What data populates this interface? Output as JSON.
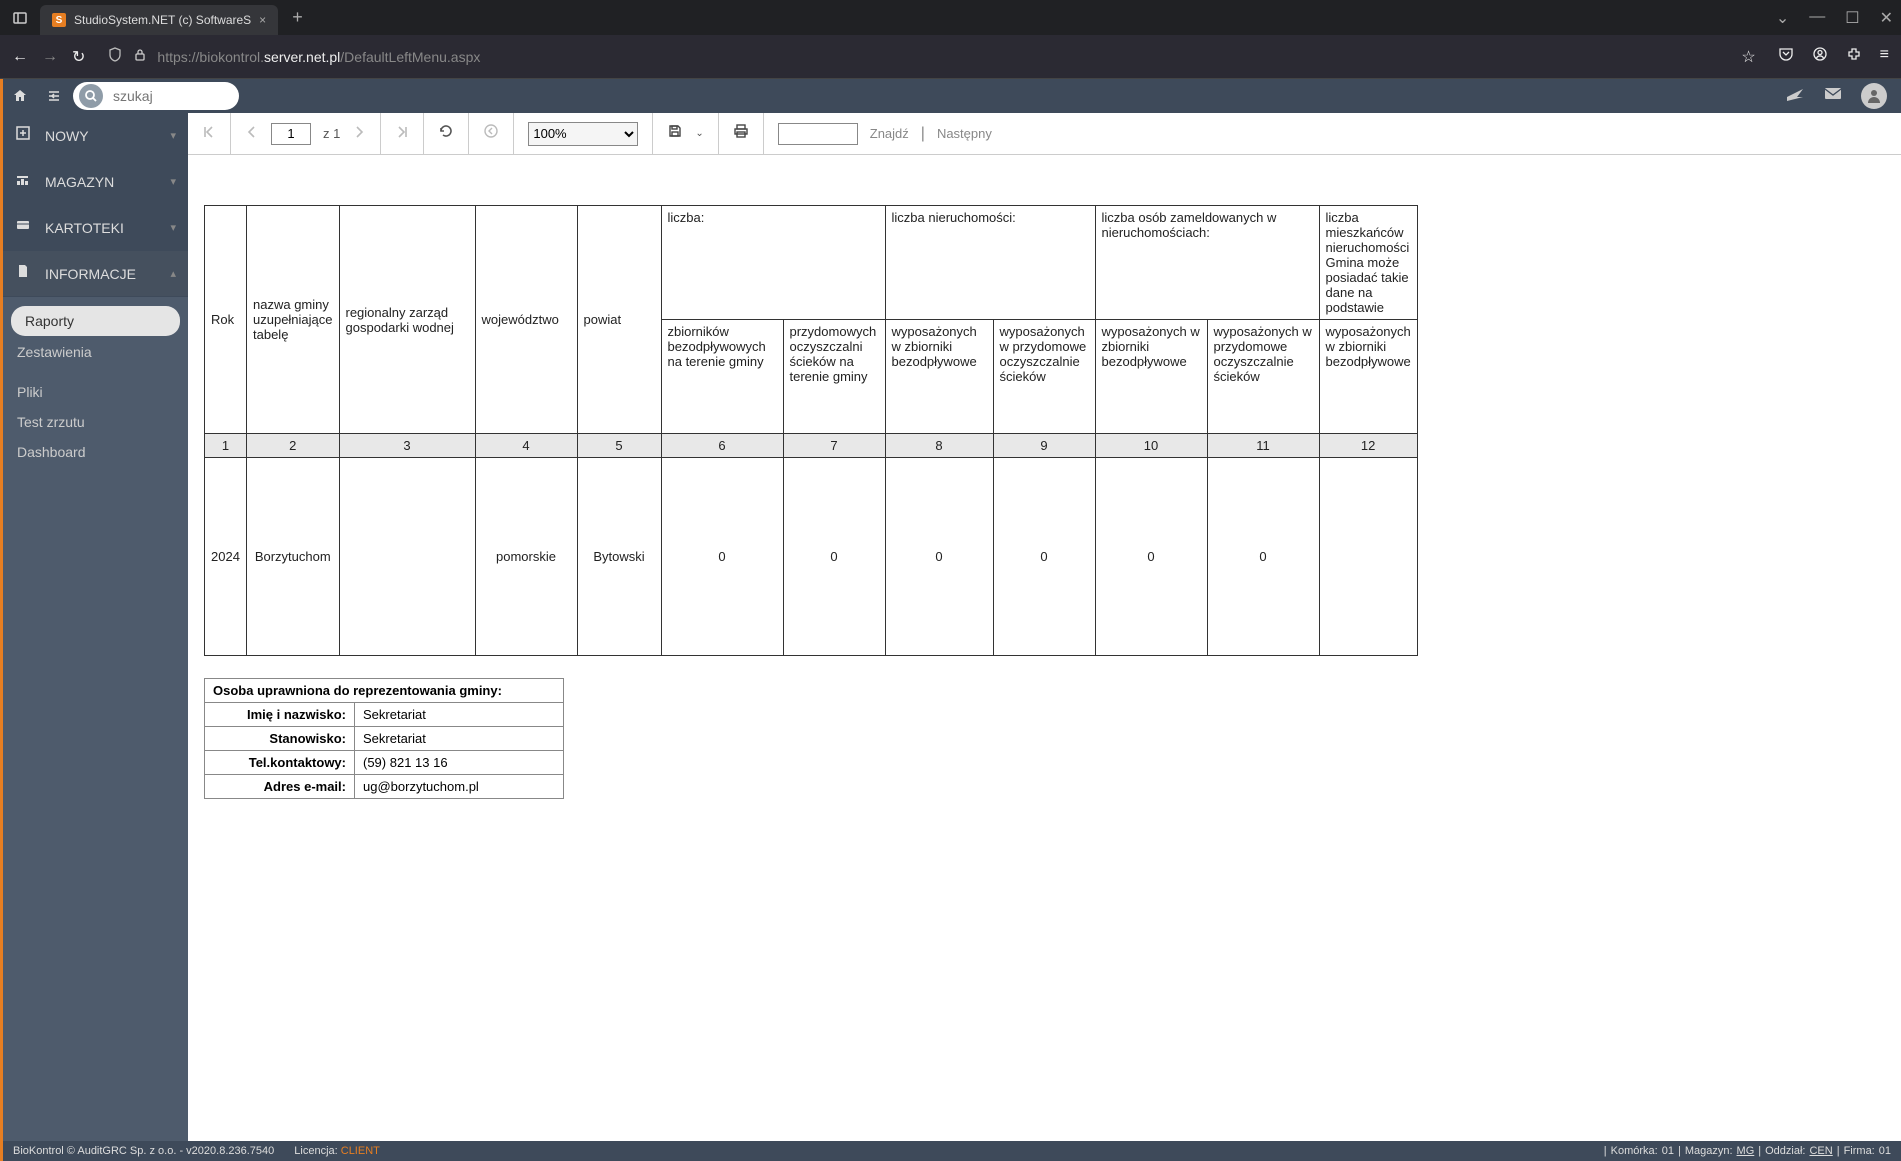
{
  "browser": {
    "tab_title": "StudioSystem.NET (c) SoftwareS",
    "url_prefix": "https://biokontrol.",
    "url_mid": "server.net.pl",
    "url_suffix": "/DefaultLeftMenu.aspx"
  },
  "search": {
    "placeholder": "szukaj"
  },
  "sidebar": {
    "items": [
      {
        "label": "NOWY"
      },
      {
        "label": "MAGAZYN"
      },
      {
        "label": "KARTOTEKI"
      },
      {
        "label": "INFORMACJE"
      }
    ],
    "sub": [
      {
        "label": "Raporty",
        "active": true
      },
      {
        "label": "Zestawienia",
        "active": false
      },
      {
        "label": "Pliki",
        "active": false
      },
      {
        "label": "Test zrzutu",
        "active": false
      },
      {
        "label": "Dashboard",
        "active": false
      }
    ]
  },
  "report_toolbar": {
    "page_value": "1",
    "page_of_prefix": "z ",
    "page_of": "1",
    "zoom": "100%",
    "find_label": "Znajdź",
    "next_label": "Następny"
  },
  "table": {
    "group_headers": {
      "liczba": "liczba:",
      "liczba_nieruch": "liczba nieruchomości:",
      "liczba_osob": "liczba osób zameldowanych w nieruchomościach:",
      "liczba_mies": "liczba mieszkańców nieruchomości Gmina może posiadać takie dane na podstawie"
    },
    "columns": [
      "Rok",
      "nazwa gminy uzupełniające tabelę",
      "regionalny zarząd gospodarki wodnej",
      "województwo",
      "powiat",
      "zbiorników bezodpływowych na terenie gminy",
      "przydomowych oczyszczalni ścieków na terenie gminy",
      "wyposażonych w zbiorniki bezodpływowe",
      "wyposażonych w przydomowe oczyszczalnie ścieków",
      "wyposażonych w zbiorniki bezodpływowe",
      "wyposażonych w przydomowe oczyszczalnie ścieków",
      "wyposażonych w zbiorniki bezodpływowe"
    ],
    "numrow": [
      "1",
      "2",
      "3",
      "4",
      "5",
      "6",
      "7",
      "8",
      "9",
      "10",
      "11",
      "12"
    ],
    "data": {
      "rok": "2024",
      "gmina": "Borzytuchom",
      "rzgw": "",
      "woj": "pomorskie",
      "powiat": "Bytowski",
      "c6": "0",
      "c7": "0",
      "c8": "0",
      "c9": "0",
      "c10": "0",
      "c11": "0",
      "c12": ""
    }
  },
  "contact": {
    "header": "Osoba uprawniona do reprezentowania gminy:",
    "rows": [
      {
        "label": "Imię i nazwisko:",
        "value": "Sekretariat"
      },
      {
        "label": "Stanowisko:",
        "value": "Sekretariat"
      },
      {
        "label": "Tel.kontaktowy:",
        "value": "(59) 821 13 16"
      },
      {
        "label": "Adres e-mail:",
        "value": "ug@borzytuchom.pl"
      }
    ]
  },
  "footer": {
    "left1": "BioKontrol © AuditGRC Sp. z o.o. - v2020.8.236.7540",
    "lic_label": "Licencja:",
    "lic_value": "CLIENT",
    "komorka_label": "Komórka:",
    "komorka_value": "01",
    "magazyn_label": "Magazyn:",
    "magazyn_value": "MG",
    "oddzial_label": "Oddział:",
    "oddzial_value": "CEN",
    "firma_label": "Firma:",
    "firma_value": "01"
  }
}
